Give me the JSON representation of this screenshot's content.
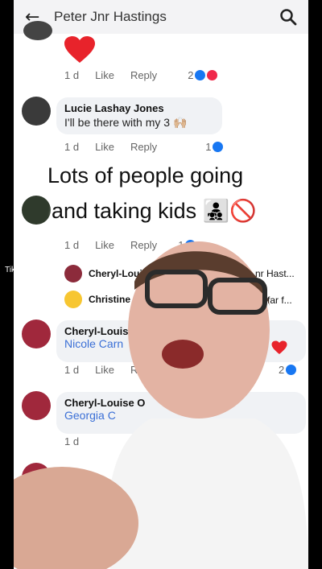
{
  "header": {
    "title": "Peter Jnr Hastings"
  },
  "comments": [
    {
      "time": "1 d",
      "like": "Like",
      "reply": "Reply",
      "count": "2"
    },
    {
      "name": "Lucie Lashay Jones",
      "text": "I'll be there with my 3 🙌🏼",
      "time": "1 d",
      "like": "Like",
      "reply": "Reply",
      "count": "1"
    },
    {
      "time": "1 d",
      "like": "Like",
      "reply": "Reply",
      "count": "1"
    },
    {
      "name": "Cheryl-Louis",
      "link": "Nicole Carn",
      "time": "1 d",
      "like": "Like",
      "reply": "R",
      "count": "2"
    },
    {
      "name": "Cheryl-Louise O",
      "link": "Georgia C",
      "time": "1 d"
    }
  ],
  "reply_rows": [
    {
      "name": "Cheryl-Louis",
      "tail": "nr Hast..."
    },
    {
      "name": "Christine H",
      "tail": "far f..."
    }
  ],
  "caption": {
    "line1": "Lots of people going",
    "line2": "and taking kids 👨‍👧‍👦🚫"
  },
  "watermark": "TikTok",
  "colors": {
    "link": "#3a6fd6",
    "like": "#1877f2",
    "love": "#f0284a"
  }
}
